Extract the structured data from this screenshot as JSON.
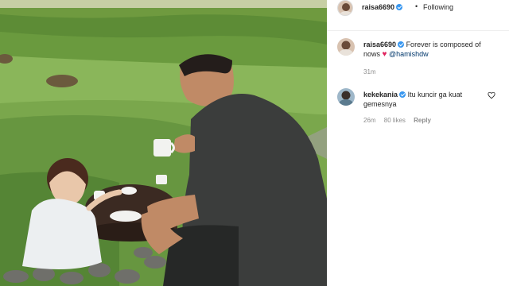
{
  "post": {
    "author": "raisa6690",
    "follow_status": "Following",
    "separator": "•"
  },
  "comments": [
    {
      "user": "raisa6690",
      "text": "Forever is composed of nows",
      "mention": "@hamishdw",
      "time": "31m"
    },
    {
      "user": "kekekania",
      "text": "Itu kuncir ga kuat gemesnya",
      "time": "26m",
      "likes": "80 likes",
      "reply_label": "Reply"
    }
  ],
  "icons": {
    "verified": "verified-badge-icon",
    "heart": "heart-outline-icon"
  },
  "colors": {
    "verified": "#3897f0",
    "mention": "#00376b",
    "meta": "#8e8e8e",
    "heart_emoji": "#e0245e"
  }
}
